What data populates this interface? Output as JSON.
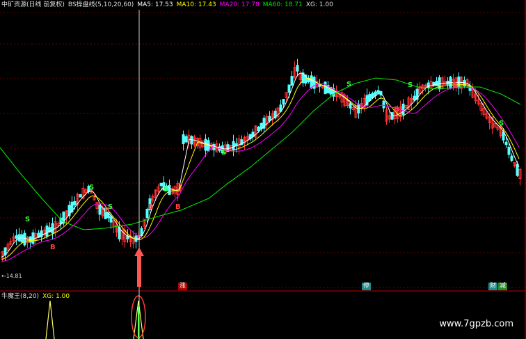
{
  "header": {
    "stock": "中矿资源(日线 前复权)",
    "indicator": "BS操盘线(5,10,20,60)",
    "ma5": "MA5: 17.53",
    "ma10": "MA10: 17.43",
    "ma20": "MA20: 17.78",
    "ma60": "MA60: 18.71",
    "xg": "XG: 1.00"
  },
  "subpanel": {
    "title": "牛魔王(8,20)",
    "xg": "XG: 1.00"
  },
  "low_price_label": "←14.81",
  "watermark": "www.7gpzb.com",
  "event_markers": [
    "涨",
    "停",
    "财",
    "减"
  ],
  "colors": {
    "up": "#ff3232",
    "down": "#54ffff",
    "ma5": "#ffffff",
    "ma10": "#ffff00",
    "ma20": "#ff00ff",
    "ma60": "#00e600",
    "grid": "#8b0000",
    "signal": "#ffff66",
    "arrow": "#ff5555"
  },
  "chart_data": {
    "type": "candlestick",
    "period": "daily",
    "min_price": 14.81,
    "signal_labels": [
      "B",
      "S"
    ],
    "subpanel_signal_count": 2
  }
}
